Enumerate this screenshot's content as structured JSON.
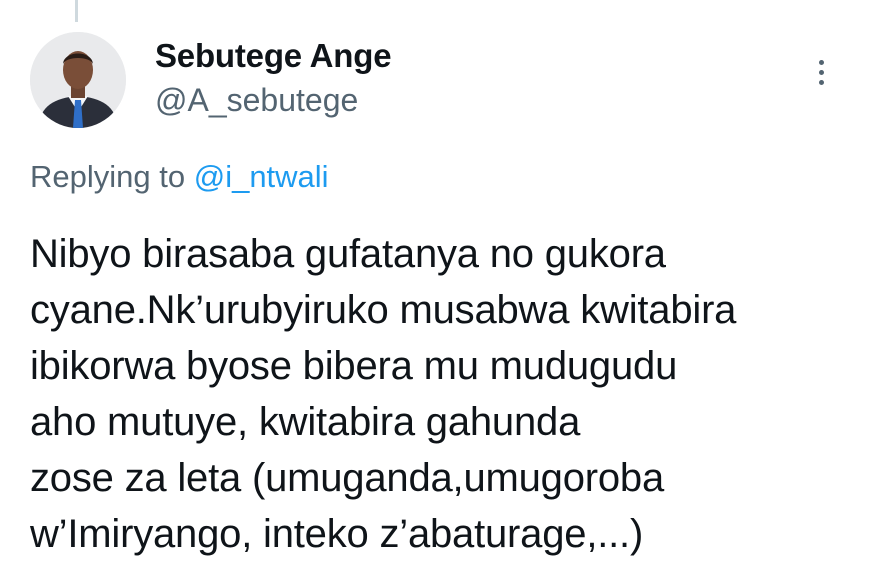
{
  "author": {
    "name": "Sebutege Ange",
    "handle": "@A_sebutege",
    "avatar_icon": "profile-photo"
  },
  "reply_context": {
    "prefix": "Replying to ",
    "mention": "@i_ntwali"
  },
  "tweet": {
    "lines": [
      "Nibyo birasaba gufatanya no gukora",
      "cyane.Nk’urubyiruko musabwa kwitabira",
      "ibikorwa byose bibera mu mudugudu",
      "aho mutuye, kwitabira gahunda",
      "zose za leta (umuganda,umugoroba",
      "w’Imiryango, inteko z’abaturage,...)"
    ]
  },
  "colors": {
    "text_primary": "#0f1419",
    "text_secondary": "#536471",
    "link": "#1d9bf0"
  },
  "icons": {
    "more": "more-vertical-icon"
  }
}
